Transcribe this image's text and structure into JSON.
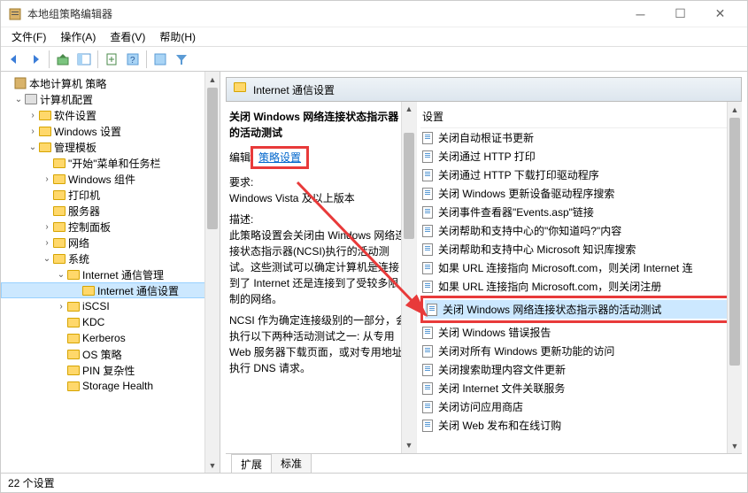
{
  "window": {
    "title": "本地组策略编辑器"
  },
  "menu": {
    "file": "文件(F)",
    "action": "操作(A)",
    "view": "查看(V)",
    "help": "帮助(H)"
  },
  "tree": {
    "root": "本地计算机 策略",
    "computer": "计算机配置",
    "software": "软件设置",
    "windows": "Windows 设置",
    "admin": "管理模板",
    "start": "\"开始\"菜单和任务栏",
    "wincomp": "Windows 组件",
    "printer": "打印机",
    "server": "服务器",
    "ctrlpanel": "控制面板",
    "network": "网络",
    "system": "系统",
    "internet_mgmt": "Internet 通信管理",
    "internet_set": "Internet 通信设置",
    "iscsi": "iSCSI",
    "kdc": "KDC",
    "kerberos": "Kerberos",
    "os_policy": "OS 策略",
    "pin": "PIN 复杂性",
    "storage": "Storage Health"
  },
  "header": {
    "title": "Internet 通信设置"
  },
  "desc": {
    "title": "关闭 Windows 网络连接状态指示器的活动测试",
    "edit_label": "编辑",
    "policy_link": "策略设置",
    "req_label": "要求:",
    "req_text": "Windows Vista 及以上版本",
    "desc_label": "描述:",
    "desc_text": "此策略设置会关闭由 Windows 网络连接状态指示器(NCSI)执行的活动测试。这些测试可以确定计算机是连接到了 Internet 还是连接到了受较多限制的网络。",
    "ncsi_text": "NCSI 作为确定连接级别的一部分，会执行以下两种活动测试之一: 从专用 Web 服务器下载页面，或对专用地址执行 DNS 请求。"
  },
  "list": {
    "header": "设置",
    "items": [
      "关闭自动根证书更新",
      "关闭通过 HTTP 打印",
      "关闭通过 HTTP 下载打印驱动程序",
      "关闭 Windows 更新设备驱动程序搜索",
      "关闭事件查看器\"Events.asp\"链接",
      "关闭帮助和支持中心的\"你知道吗?\"内容",
      "关闭帮助和支持中心 Microsoft 知识库搜索",
      "如果 URL 连接指向 Microsoft.com，则关闭 Internet 连",
      "如果 URL 连接指向 Microsoft.com，则关闭注册",
      "关闭 Windows 网络连接状态指示器的活动测试",
      "关闭 Windows 错误报告",
      "关闭对所有 Windows 更新功能的访问",
      "关闭搜索助理内容文件更新",
      "关闭 Internet 文件关联服务",
      "关闭访问应用商店",
      "关闭 Web 发布和在线订购"
    ]
  },
  "tabs": {
    "ext": "扩展",
    "std": "标准"
  },
  "status": {
    "count": "22 个设置"
  }
}
